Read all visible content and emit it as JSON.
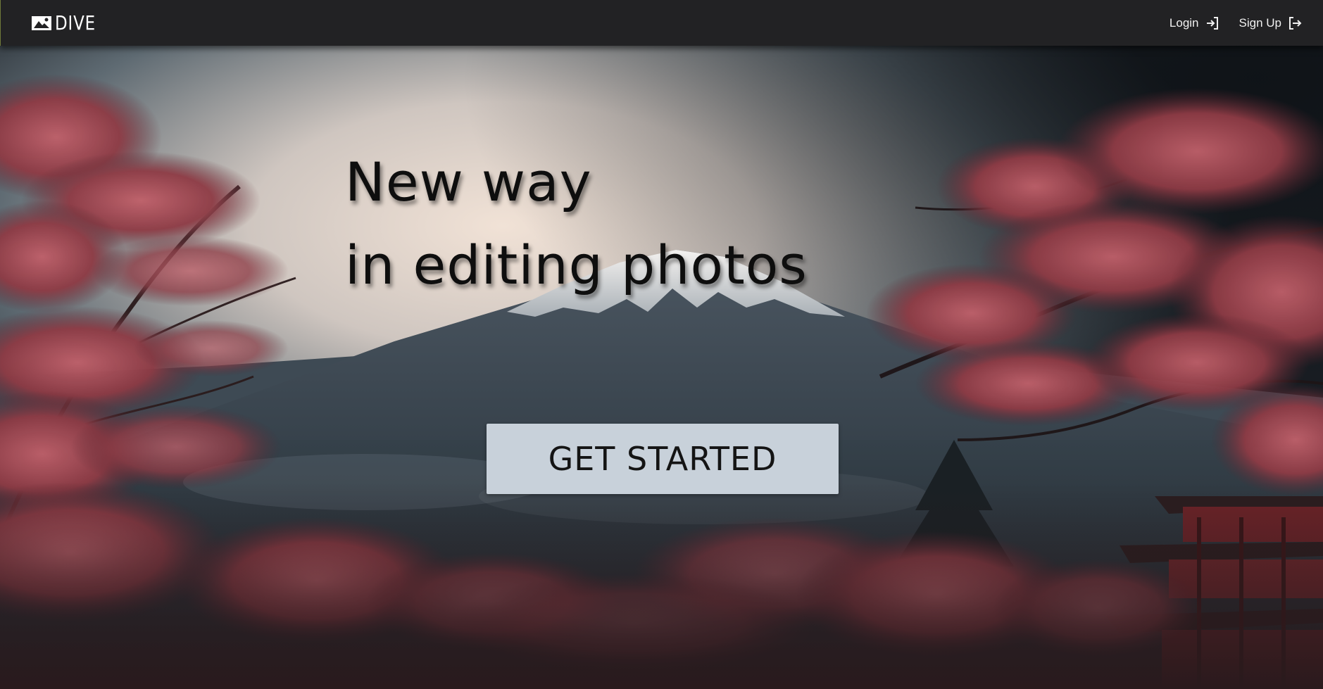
{
  "brand": {
    "name": "DIVE",
    "logo_icon": "photo-icon"
  },
  "nav": {
    "login_label": "Login",
    "login_icon": "login-icon",
    "signup_label": "Sign Up",
    "signup_icon": "signout-arrow-icon"
  },
  "hero": {
    "headline_line1": "New way",
    "headline_line2": "in editing photos",
    "cta_label": "GET STARTED"
  },
  "colors": {
    "navbar_bg": "#222224",
    "cta_bg": "#c8d1da",
    "headline_text": "#0e0e0e",
    "blossom": "#a84a52"
  }
}
